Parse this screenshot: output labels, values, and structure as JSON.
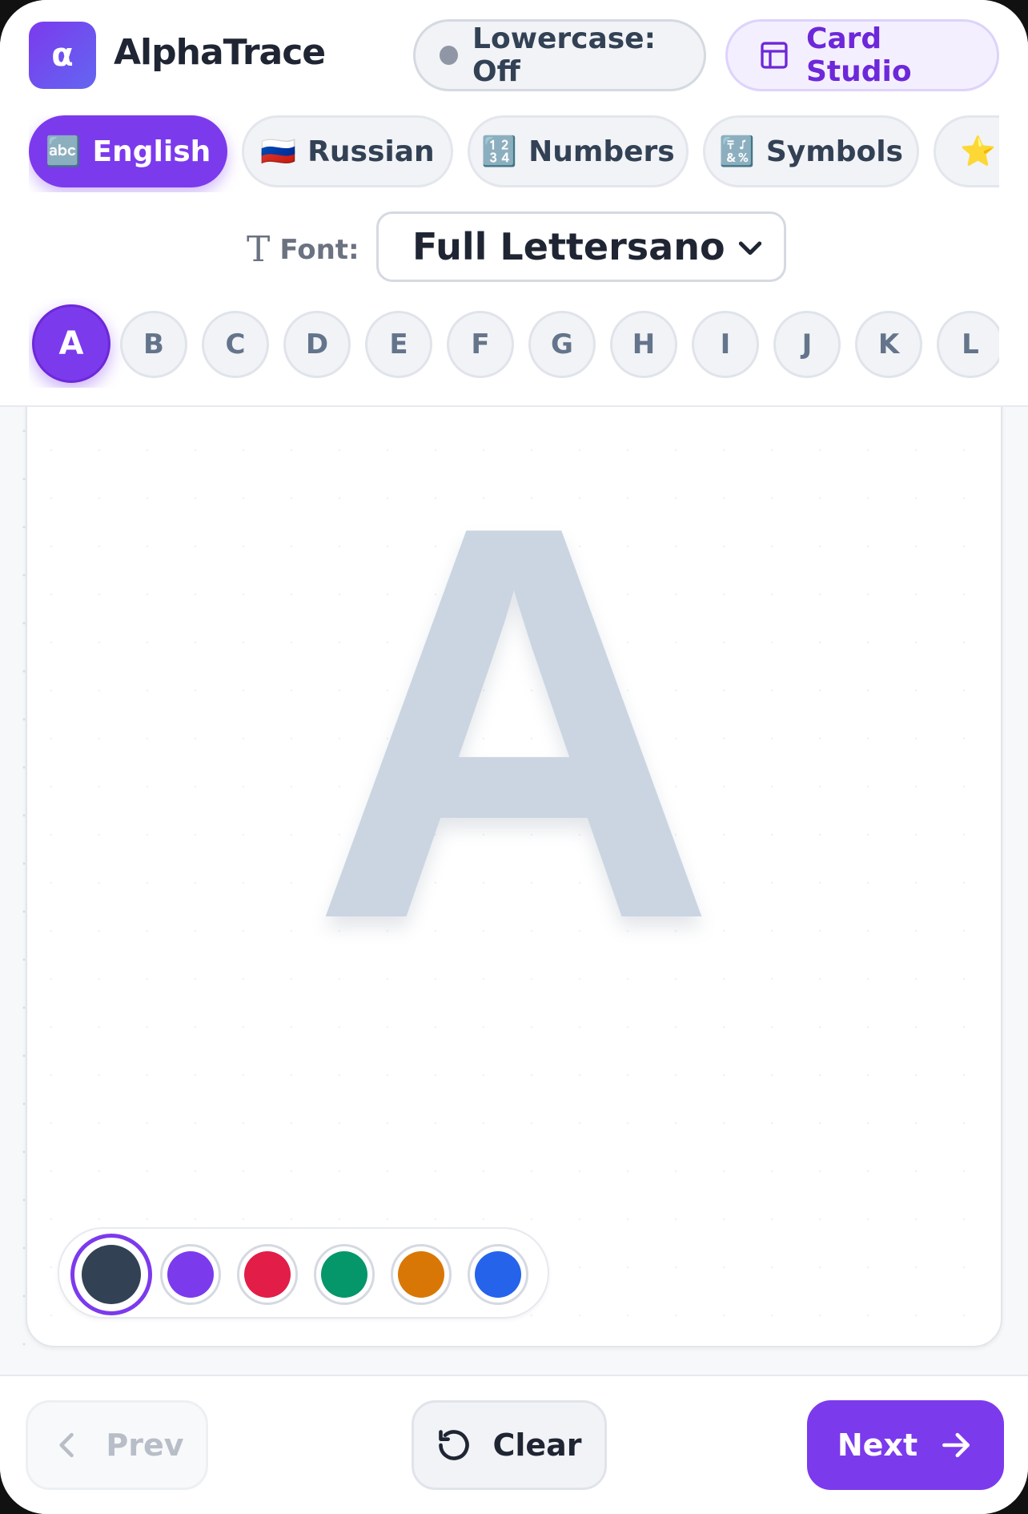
{
  "app": {
    "logo_glyph": "α",
    "title": "AlphaTrace"
  },
  "header": {
    "lowercase_label": "Lowercase: Off",
    "studio_label": "Card Studio"
  },
  "tabs": [
    {
      "icon": "🔤",
      "label": "English",
      "active": true
    },
    {
      "icon": "🇷🇺",
      "label": "Russian",
      "active": false
    },
    {
      "icon": "🔢",
      "label": "Numbers",
      "active": false
    },
    {
      "icon": "🔣",
      "label": "Symbols",
      "active": false
    },
    {
      "icon": "⭐",
      "label": "",
      "active": false
    }
  ],
  "font": {
    "label": "Font:",
    "selected": "Full Lettersano"
  },
  "letters": [
    "A",
    "B",
    "C",
    "D",
    "E",
    "F",
    "G",
    "H",
    "I",
    "J",
    "K",
    "L"
  ],
  "current_letter": "A",
  "palette": [
    "#334155",
    "#7c3aed",
    "#e11d48",
    "#059669",
    "#d97706",
    "#2563eb"
  ],
  "selected_color": "#334155",
  "footer": {
    "prev_label": "Prev",
    "clear_label": "Clear",
    "next_label": "Next"
  },
  "colors": {
    "accent": "#7c3aed",
    "trace": "#cbd5e1",
    "text": "#1f2533"
  }
}
